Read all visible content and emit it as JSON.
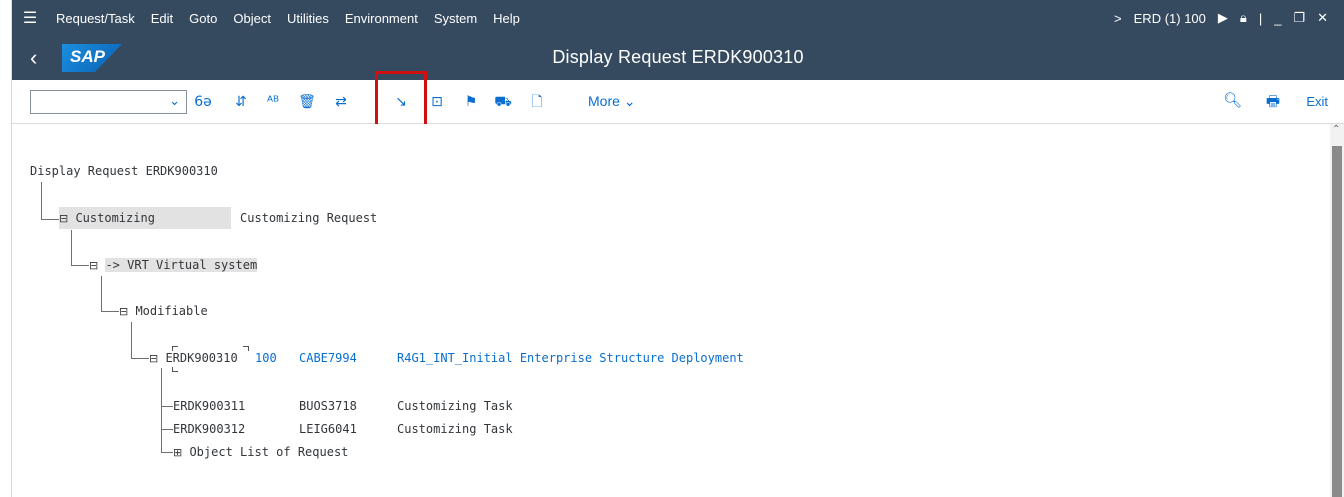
{
  "menu": {
    "items": [
      "Request/Task",
      "Edit",
      "Goto",
      "Object",
      "Utilities",
      "Environment",
      "System",
      "Help"
    ],
    "system_info": "ERD (1) 100"
  },
  "title": {
    "logo": "SAP",
    "text": "Display Request ERDK900310"
  },
  "toolbar": {
    "more_label": "More",
    "exit_label": "Exit",
    "icons": [
      "display-change-icon",
      "hierarchy-icon",
      "sort-icon",
      "delete-icon",
      "transport-icon",
      "import-icon",
      "object-list-icon",
      "flag-icon",
      "truck-icon",
      "document-icon"
    ]
  },
  "tree": {
    "heading": "Display Request ERDK900310",
    "customizing": {
      "label": "Customizing",
      "description": "Customizing Request"
    },
    "target": {
      "label": "-> VRT Virtual system"
    },
    "modifiable": {
      "label": "Modifiable"
    },
    "request": {
      "number": "ERDK900310",
      "client": "100",
      "owner": "CABE7994",
      "description": "R4G1_INT_Initial Enterprise Structure Deployment"
    },
    "tasks": [
      {
        "number": "ERDK900311",
        "owner": "BUOS3718",
        "description": "Customizing Task"
      },
      {
        "number": "ERDK900312",
        "owner": "LEIG6041",
        "description": "Customizing Task"
      }
    ],
    "object_list": "Object List of Request"
  },
  "colors": {
    "shell": "#354a5f",
    "link": "#0a6ed1",
    "highlight_box": "#d01010"
  }
}
